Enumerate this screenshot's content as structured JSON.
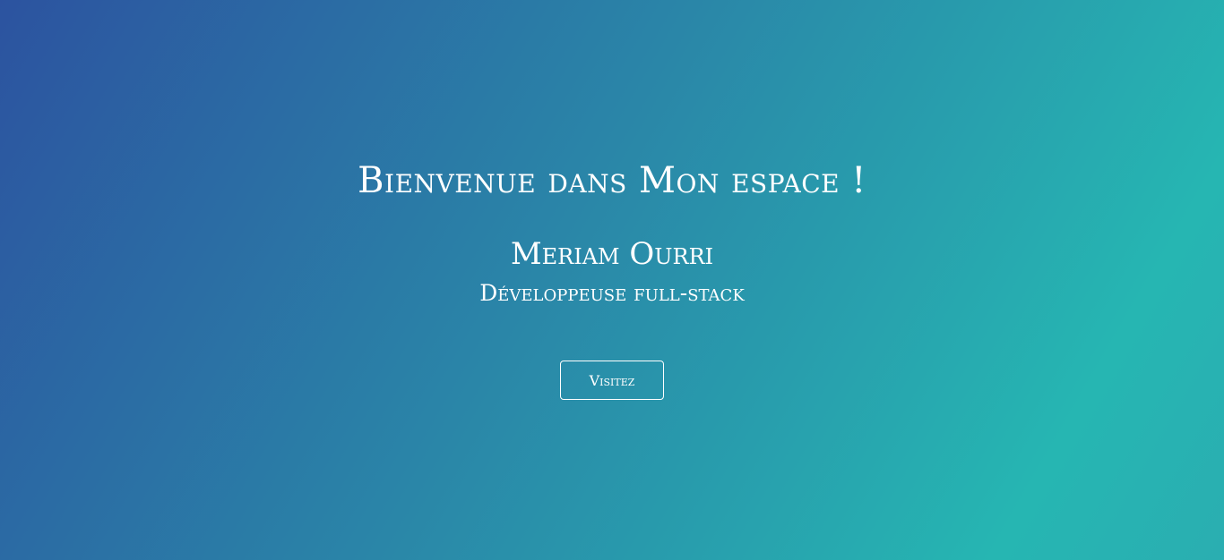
{
  "hero": {
    "headline": "Bienvenue dans Mon espace !",
    "name": "Meriam Ourri",
    "role": "Développeuse full-stack",
    "cta_label": "Visitez"
  },
  "colors": {
    "gradient_start": "#2c53a0",
    "gradient_mid": "#2a86a8",
    "gradient_end": "#26b6b2",
    "text": "#ffffff"
  }
}
